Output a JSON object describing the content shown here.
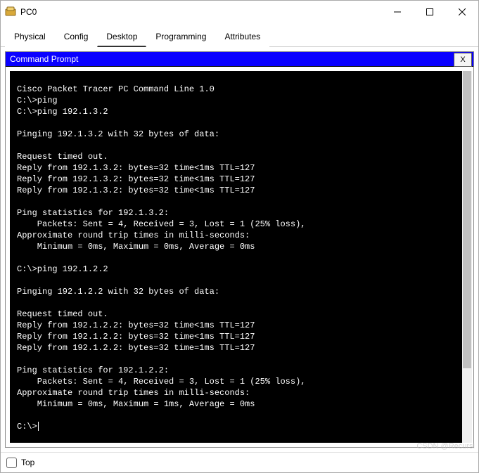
{
  "window": {
    "title": "PC0"
  },
  "tabs": [
    "Physical",
    "Config",
    "Desktop",
    "Programming",
    "Attributes"
  ],
  "active_tab_index": 2,
  "cmd": {
    "title": "Command Prompt",
    "close": "X"
  },
  "terminal_lines": [
    "Cisco Packet Tracer PC Command Line 1.0",
    "C:\\>ping",
    "C:\\>ping 192.1.3.2",
    "",
    "Pinging 192.1.3.2 with 32 bytes of data:",
    "",
    "Request timed out.",
    "Reply from 192.1.3.2: bytes=32 time<1ms TTL=127",
    "Reply from 192.1.3.2: bytes=32 time<1ms TTL=127",
    "Reply from 192.1.3.2: bytes=32 time<1ms TTL=127",
    "",
    "Ping statistics for 192.1.3.2:",
    "    Packets: Sent = 4, Received = 3, Lost = 1 (25% loss),",
    "Approximate round trip times in milli-seconds:",
    "    Minimum = 0ms, Maximum = 0ms, Average = 0ms",
    "",
    "C:\\>ping 192.1.2.2",
    "",
    "Pinging 192.1.2.2 with 32 bytes of data:",
    "",
    "Request timed out.",
    "Reply from 192.1.2.2: bytes=32 time<1ms TTL=127",
    "Reply from 192.1.2.2: bytes=32 time<1ms TTL=127",
    "Reply from 192.1.2.2: bytes=32 time=1ms TTL=127",
    "",
    "Ping statistics for 192.1.2.2:",
    "    Packets: Sent = 4, Received = 3, Lost = 1 (25% loss),",
    "Approximate round trip times in milli-seconds:",
    "    Minimum = 0ms, Maximum = 1ms, Average = 0ms",
    "",
    "C:\\>"
  ],
  "footer": {
    "top_label": "Top"
  },
  "watermark": "CSDN @Recursi"
}
